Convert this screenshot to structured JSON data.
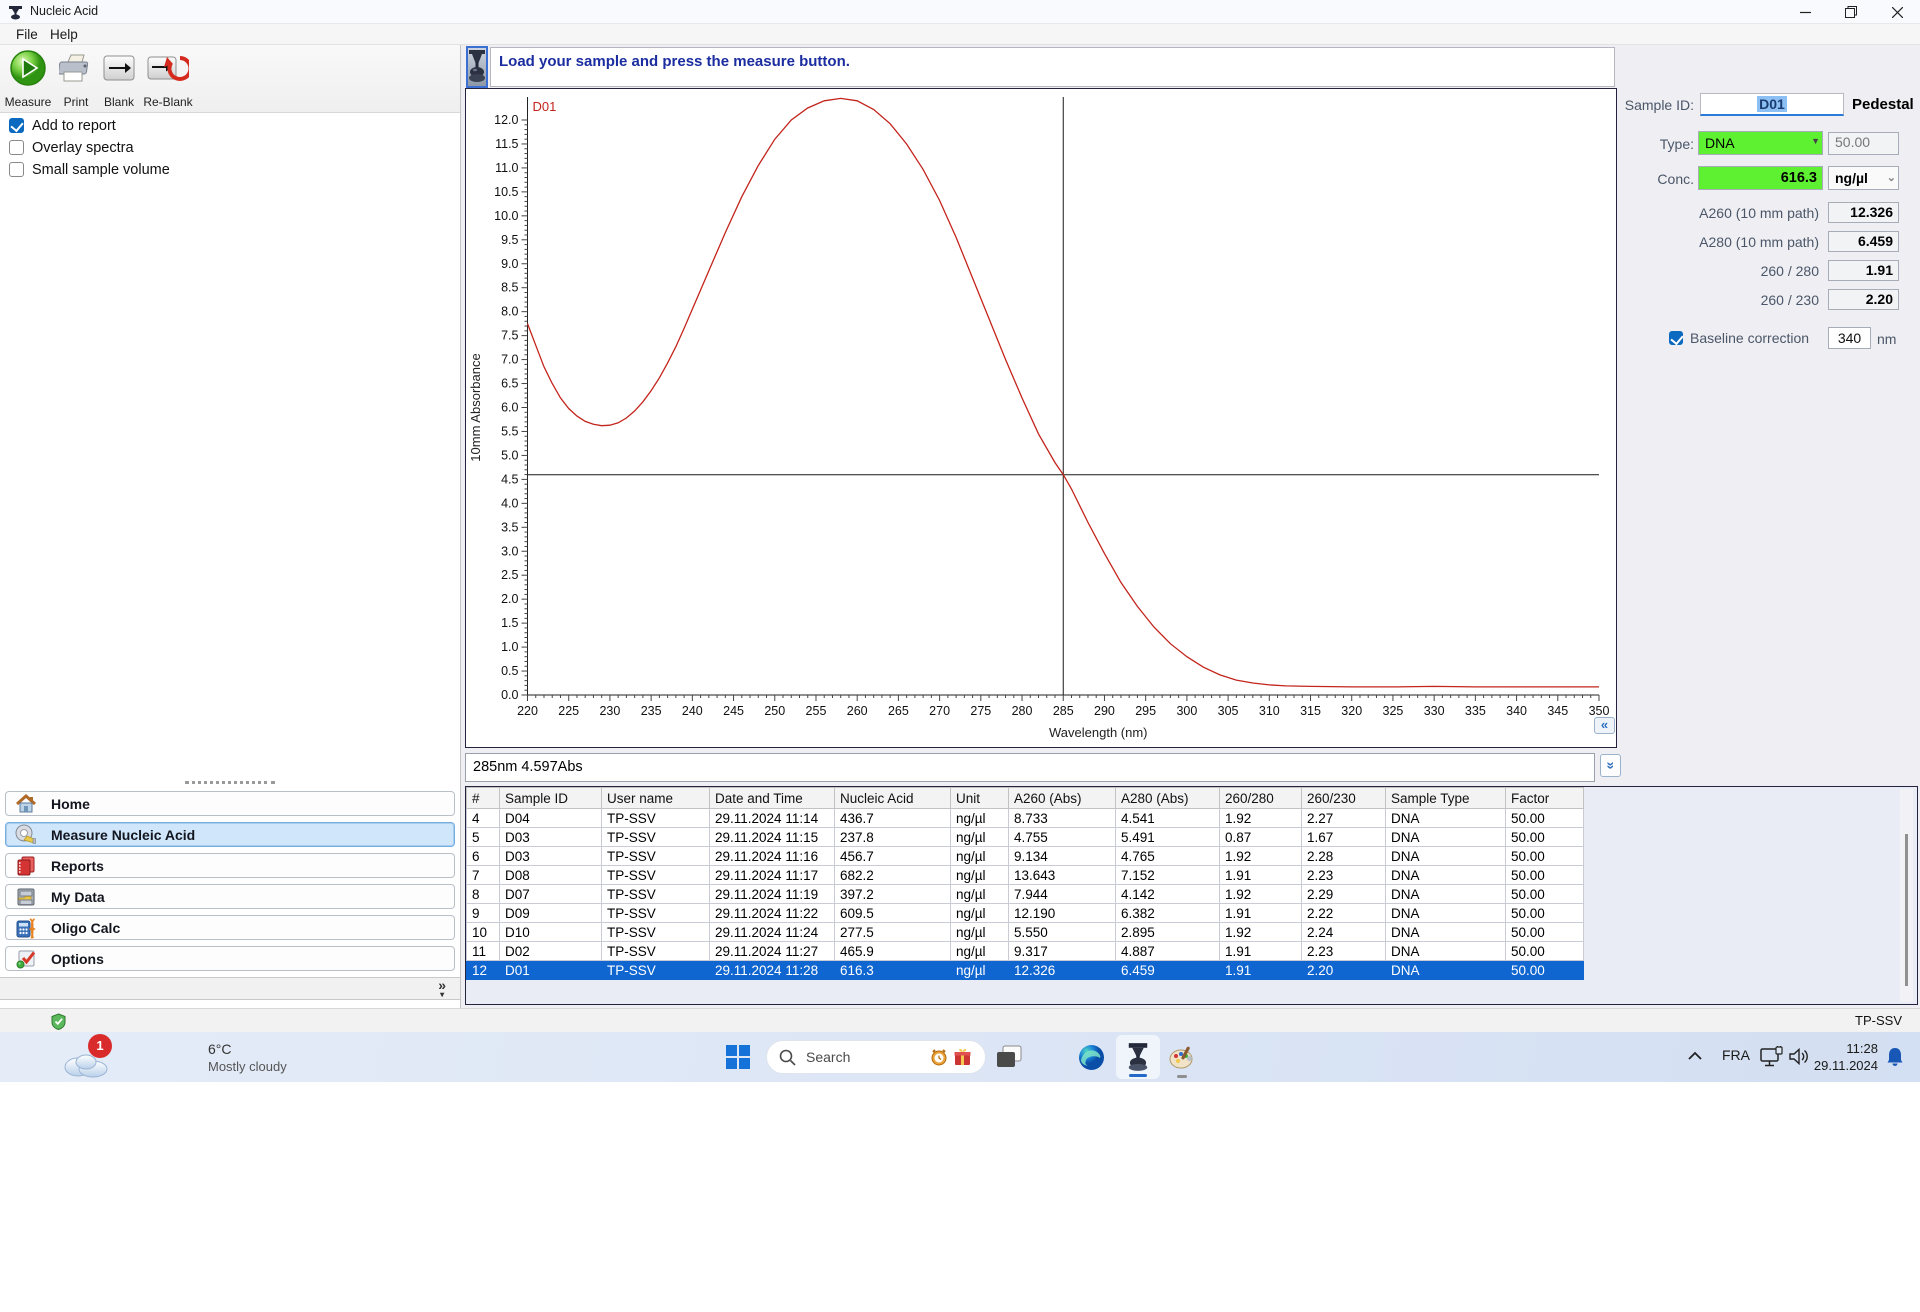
{
  "window": {
    "title": "Nucleic Acid",
    "menu": [
      "File",
      "Help"
    ]
  },
  "toolbar": {
    "buttons": [
      {
        "label": "Measure"
      },
      {
        "label": "Print"
      },
      {
        "label": "Blank"
      },
      {
        "label": "Re-Blank"
      }
    ]
  },
  "options": [
    {
      "label": "Add to report",
      "checked": true
    },
    {
      "label": "Overlay spectra",
      "checked": false
    },
    {
      "label": "Small sample volume",
      "checked": false
    }
  ],
  "message_bar": {
    "text": "Load your sample and press the measure button."
  },
  "chart_data": {
    "type": "line",
    "xlabel": "Wavelength (nm)",
    "ylabel": "10mm Absorbance",
    "xlim": [
      220,
      350
    ],
    "ylim": [
      0,
      12.0
    ],
    "x_major_step": 5,
    "x_minor_step": 1,
    "y_major_step": 0.5,
    "y_minor_step": 0.1,
    "grid": false,
    "crosshair": {
      "x": 285,
      "y": 4.597
    },
    "line_color": "#c3241c",
    "series": [
      {
        "name": "D01",
        "points": [
          [
            220,
            7.75
          ],
          [
            221,
            7.3
          ],
          [
            222,
            6.85
          ],
          [
            223,
            6.5
          ],
          [
            224,
            6.2
          ],
          [
            225,
            5.98
          ],
          [
            226,
            5.82
          ],
          [
            227,
            5.71
          ],
          [
            228,
            5.65
          ],
          [
            229,
            5.62
          ],
          [
            230,
            5.63
          ],
          [
            231,
            5.68
          ],
          [
            232,
            5.78
          ],
          [
            233,
            5.93
          ],
          [
            234,
            6.12
          ],
          [
            235,
            6.35
          ],
          [
            236,
            6.62
          ],
          [
            237,
            6.93
          ],
          [
            238,
            7.27
          ],
          [
            239,
            7.65
          ],
          [
            240,
            8.05
          ],
          [
            242,
            8.85
          ],
          [
            244,
            9.65
          ],
          [
            246,
            10.4
          ],
          [
            248,
            11.05
          ],
          [
            250,
            11.6
          ],
          [
            252,
            12.0
          ],
          [
            254,
            12.25
          ],
          [
            256,
            12.4
          ],
          [
            258,
            12.45
          ],
          [
            260,
            12.4
          ],
          [
            262,
            12.22
          ],
          [
            264,
            11.92
          ],
          [
            266,
            11.5
          ],
          [
            268,
            10.97
          ],
          [
            270,
            10.32
          ],
          [
            272,
            9.55
          ],
          [
            274,
            8.7
          ],
          [
            276,
            7.85
          ],
          [
            278,
            7.0
          ],
          [
            280,
            6.2
          ],
          [
            282,
            5.45
          ],
          [
            284,
            4.85
          ],
          [
            285,
            4.597
          ],
          [
            286,
            4.3
          ],
          [
            288,
            3.6
          ],
          [
            290,
            2.95
          ],
          [
            292,
            2.35
          ],
          [
            294,
            1.85
          ],
          [
            296,
            1.42
          ],
          [
            298,
            1.07
          ],
          [
            300,
            0.8
          ],
          [
            302,
            0.58
          ],
          [
            304,
            0.42
          ],
          [
            306,
            0.31
          ],
          [
            308,
            0.25
          ],
          [
            310,
            0.21
          ],
          [
            312,
            0.19
          ],
          [
            315,
            0.18
          ],
          [
            320,
            0.17
          ],
          [
            325,
            0.17
          ],
          [
            330,
            0.18
          ],
          [
            335,
            0.17
          ],
          [
            340,
            0.17
          ],
          [
            345,
            0.17
          ],
          [
            350,
            0.17
          ]
        ]
      }
    ]
  },
  "status_readout": "285nm 4.597Abs",
  "results_table": {
    "columns": [
      "#",
      "Sample ID",
      "User name",
      "Date and Time",
      "Nucleic Acid",
      "Unit",
      "A260 (Abs)",
      "A280 (Abs)",
      "260/280",
      "260/230",
      "Sample Type",
      "Factor"
    ],
    "rows": [
      [
        "4",
        "D04",
        "TP-SSV",
        "29.11.2024 11:14",
        "436.7",
        "ng/µl",
        "8.733",
        "4.541",
        "1.92",
        "2.27",
        "DNA",
        "50.00"
      ],
      [
        "5",
        "D03",
        "TP-SSV",
        "29.11.2024 11:15",
        "237.8",
        "ng/µl",
        "4.755",
        "5.491",
        "0.87",
        "1.67",
        "DNA",
        "50.00"
      ],
      [
        "6",
        "D03",
        "TP-SSV",
        "29.11.2024 11:16",
        "456.7",
        "ng/µl",
        "9.134",
        "4.765",
        "1.92",
        "2.28",
        "DNA",
        "50.00"
      ],
      [
        "7",
        "D08",
        "TP-SSV",
        "29.11.2024 11:17",
        "682.2",
        "ng/µl",
        "13.643",
        "7.152",
        "1.91",
        "2.23",
        "DNA",
        "50.00"
      ],
      [
        "8",
        "D07",
        "TP-SSV",
        "29.11.2024 11:19",
        "397.2",
        "ng/µl",
        "7.944",
        "4.142",
        "1.92",
        "2.29",
        "DNA",
        "50.00"
      ],
      [
        "9",
        "D09",
        "TP-SSV",
        "29.11.2024 11:22",
        "609.5",
        "ng/µl",
        "12.190",
        "6.382",
        "1.91",
        "2.22",
        "DNA",
        "50.00"
      ],
      [
        "10",
        "D10",
        "TP-SSV",
        "29.11.2024 11:24",
        "277.5",
        "ng/µl",
        "5.550",
        "2.895",
        "1.92",
        "2.24",
        "DNA",
        "50.00"
      ],
      [
        "11",
        "D02",
        "TP-SSV",
        "29.11.2024 11:27",
        "465.9",
        "ng/µl",
        "9.317",
        "4.887",
        "1.91",
        "2.23",
        "DNA",
        "50.00"
      ],
      [
        "12",
        "D01",
        "TP-SSV",
        "29.11.2024 11:28",
        "616.3",
        "ng/µl",
        "12.326",
        "6.459",
        "1.91",
        "2.20",
        "DNA",
        "50.00"
      ]
    ],
    "selected_row_index": 8
  },
  "sample_panel": {
    "sample_id_label": "Sample ID:",
    "sample_id_value": "D01",
    "mode": "Pedestal",
    "type_label": "Type:",
    "type_value": "DNA",
    "type_factor": "50.00",
    "conc_label": "Conc.",
    "conc_value": "616.3",
    "conc_unit": "ng/µl",
    "a260_label": "A260 (10 mm path)",
    "a260_value": "12.326",
    "a280_label": "A280 (10 mm path)",
    "a280_value": "6.459",
    "ratio280_label": "260 / 280",
    "ratio280_value": "1.91",
    "ratio230_label": "260 / 230",
    "ratio230_value": "2.20",
    "baseline_label": "Baseline correction",
    "baseline_checked": true,
    "baseline_value": "340",
    "baseline_unit": "nm",
    "accent_green": "#5df132"
  },
  "sidebar": {
    "items": [
      {
        "label": "Home",
        "selected": false
      },
      {
        "label": "Measure Nucleic Acid",
        "selected": true
      },
      {
        "label": "Reports",
        "selected": false
      },
      {
        "label": "My Data",
        "selected": false
      },
      {
        "label": "Oligo Calc",
        "selected": false
      },
      {
        "label": "Options",
        "selected": false
      }
    ]
  },
  "glyphs": {
    "chart_collapse": "«",
    "status_expand": "»",
    "nav_more": "»",
    "nav_more_caret": "▾"
  },
  "icons": {
    "app_icon": "nanodrop-pedestal",
    "measure": "green-play-button",
    "print": "printer",
    "blank": "cuvette-arrow",
    "reblank": "cuvette-red-cycle",
    "security": "green-shield-check"
  },
  "app_statusbar": {
    "user": "TP-SSV"
  },
  "taskbar": {
    "weather": {
      "temp": "6°C",
      "condition": "Mostly cloudy",
      "badge": "1"
    },
    "search_placeholder": "Search",
    "language": "FRA",
    "time": "11:28",
    "date": "29.11.2024"
  }
}
